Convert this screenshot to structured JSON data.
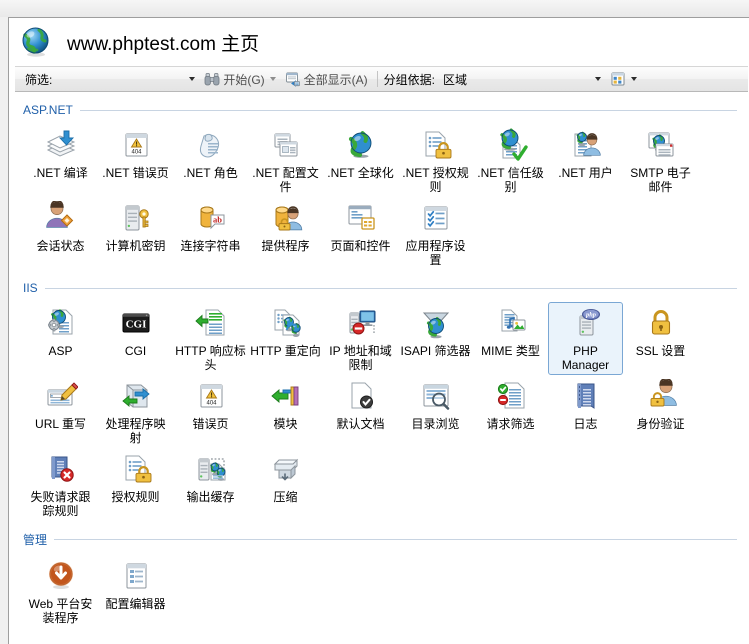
{
  "window": {
    "header": {
      "icon": "globe-icon",
      "title": "www.phptest.com 主页"
    },
    "toolbar": {
      "filter_label": "筛选:",
      "filter_value": "",
      "filter_placeholder": "",
      "start_label": "开始(G)",
      "start_accel": "G",
      "show_all_label": "全部显示(A)",
      "show_all_accel": "A",
      "group_by_label": "分组依据:",
      "group_by_value": "区域",
      "view_icon": "view-mode-icon",
      "binoculars_icon": "binoculars-icon",
      "show_all_icon": "show-all-icon"
    }
  },
  "groups": [
    {
      "id": "aspnet",
      "title": "ASP.NET",
      "items": [
        {
          "label": ".NET 编译",
          "icon": "net-compilation-icon"
        },
        {
          "label": ".NET 错误页",
          "icon": "net-error-pages-icon"
        },
        {
          "label": ".NET 角色",
          "icon": "net-roles-icon"
        },
        {
          "label": ".NET 配置文件",
          "icon": "net-profile-icon"
        },
        {
          "label": ".NET 全球化",
          "icon": "net-globalization-icon"
        },
        {
          "label": ".NET 授权规则",
          "icon": "net-authorization-rules-icon"
        },
        {
          "label": ".NET 信任级别",
          "icon": "net-trust-levels-icon"
        },
        {
          "label": ".NET 用户",
          "icon": "net-users-icon"
        },
        {
          "label": "SMTP 电子邮件",
          "icon": "smtp-email-icon"
        },
        {
          "label": "会话状态",
          "icon": "session-state-icon"
        },
        {
          "label": "计算机密钥",
          "icon": "machine-key-icon"
        },
        {
          "label": "连接字符串",
          "icon": "connection-strings-icon"
        },
        {
          "label": "提供程序",
          "icon": "providers-icon"
        },
        {
          "label": "页面和控件",
          "icon": "pages-and-controls-icon"
        },
        {
          "label": "应用程序设置",
          "icon": "application-settings-icon"
        }
      ]
    },
    {
      "id": "iis",
      "title": "IIS",
      "items": [
        {
          "label": "ASP",
          "icon": "asp-icon"
        },
        {
          "label": "CGI",
          "icon": "cgi-icon"
        },
        {
          "label": "HTTP 响应标头",
          "icon": "http-response-headers-icon"
        },
        {
          "label": "HTTP 重定向",
          "icon": "http-redirect-icon"
        },
        {
          "label": "IP 地址和域限制",
          "icon": "ip-address-domain-restrictions-icon"
        },
        {
          "label": "ISAPI 筛选器",
          "icon": "isapi-filters-icon"
        },
        {
          "label": "MIME 类型",
          "icon": "mime-types-icon"
        },
        {
          "label": "PHP Manager",
          "icon": "php-manager-icon",
          "selected": true
        },
        {
          "label": "SSL 设置",
          "icon": "ssl-settings-icon"
        },
        {
          "label": "URL 重写",
          "icon": "url-rewrite-icon"
        },
        {
          "label": "处理程序映射",
          "icon": "handler-mappings-icon"
        },
        {
          "label": "错误页",
          "icon": "error-pages-icon"
        },
        {
          "label": "模块",
          "icon": "modules-icon"
        },
        {
          "label": "默认文档",
          "icon": "default-document-icon"
        },
        {
          "label": "目录浏览",
          "icon": "directory-browsing-icon"
        },
        {
          "label": "请求筛选",
          "icon": "request-filtering-icon"
        },
        {
          "label": "日志",
          "icon": "logging-icon"
        },
        {
          "label": "身份验证",
          "icon": "authentication-icon"
        },
        {
          "label": "失败请求跟踪规则",
          "icon": "failed-request-tracing-rules-icon"
        },
        {
          "label": "授权规则",
          "icon": "authorization-rules-icon"
        },
        {
          "label": "输出缓存",
          "icon": "output-caching-icon"
        },
        {
          "label": "压缩",
          "icon": "compression-icon"
        }
      ]
    },
    {
      "id": "mgmt",
      "title": "管理",
      "items": [
        {
          "label": "Web 平台安装程序",
          "icon": "web-platform-installer-icon"
        },
        {
          "label": "配置编辑器",
          "icon": "configuration-editor-icon"
        }
      ]
    }
  ],
  "colors": {
    "group_title": "#1f5fa9",
    "selection_fill": "#eaf3fb",
    "selection_border": "#7aa7d4",
    "panel_bg": "#ffffff",
    "chrome_bg": "#f0f0f0"
  }
}
